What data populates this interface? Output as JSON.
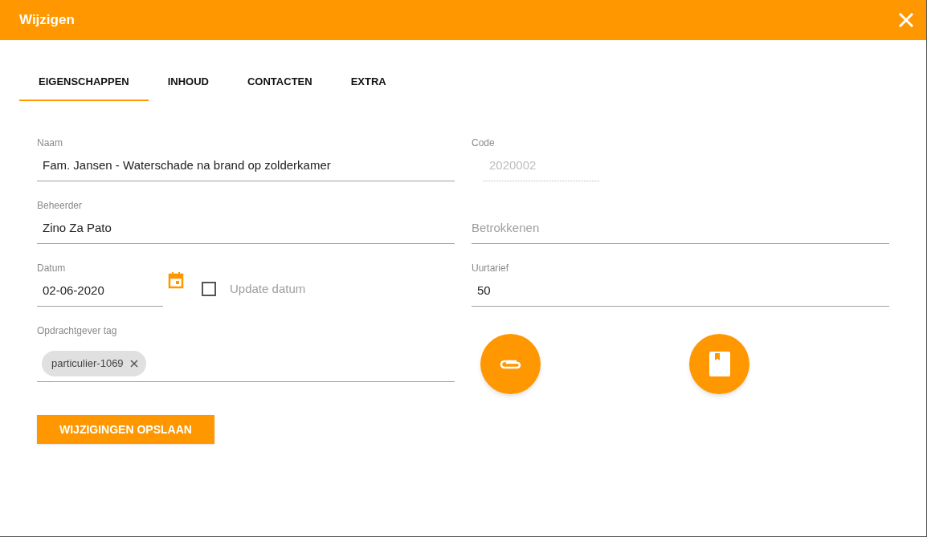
{
  "dialog": {
    "title": "Wijzigen"
  },
  "tabs": [
    {
      "label": "EIGENSCHAPPEN",
      "selected": true
    },
    {
      "label": "INHOUD",
      "selected": false
    },
    {
      "label": "CONTACTEN",
      "selected": false
    },
    {
      "label": "EXTRA",
      "selected": false
    }
  ],
  "naam": {
    "label": "Naam",
    "value": "Fam. Jansen - Waterschade na brand op zolderkamer"
  },
  "code": {
    "label": "Code",
    "value": "2020002",
    "disabled": true
  },
  "beheerder": {
    "label": "Beheerder",
    "value": "Zino Za Pato"
  },
  "betrokkenen": {
    "placeholder": "Betrokkenen"
  },
  "datum": {
    "label": "Datum",
    "value": "02-06-2020"
  },
  "update_datum": {
    "label": "Update datum",
    "checked": false
  },
  "uurtarief": {
    "label": "Uurtarief",
    "value": "50"
  },
  "opdrachtgever_tag": {
    "label": "Opdrachtgever tag",
    "chips": [
      {
        "label": "particulier-1069"
      }
    ]
  },
  "save_button": {
    "label": "WIJZIGINGEN OPSLAAN"
  }
}
